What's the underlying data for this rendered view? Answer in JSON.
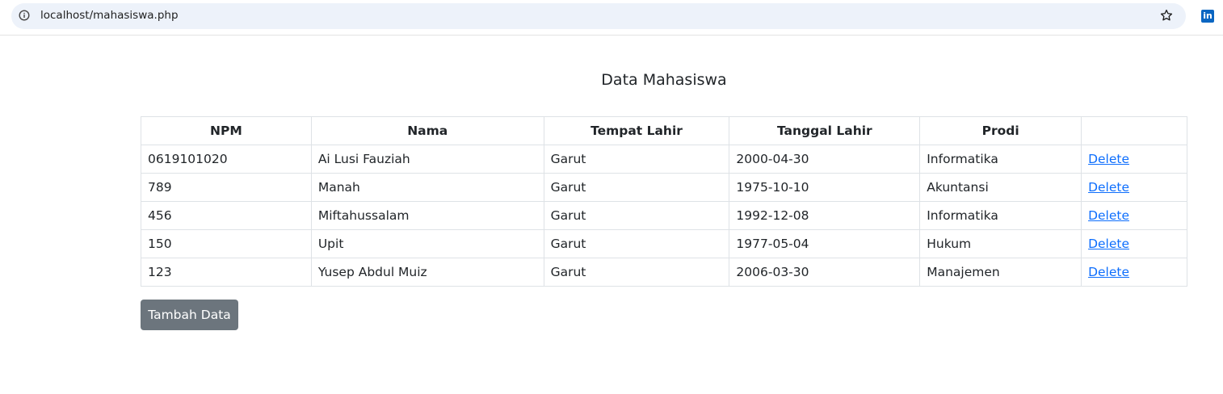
{
  "browser": {
    "url": "localhost/mahasiswa.php",
    "info_icon": "info-circle-icon",
    "bookmark_icon": "star-outline-icon",
    "extension_icon": "linkedin-icon",
    "extension_label": "in"
  },
  "page": {
    "title": "Data Mahasiswa"
  },
  "table": {
    "headers": [
      "NPM",
      "Nama",
      "Tempat Lahir",
      "Tanggal Lahir",
      "Prodi",
      ""
    ],
    "rows": [
      {
        "npm": "0619101020",
        "nama": "Ai Lusi Fauziah",
        "tempat": "Garut",
        "tanggal": "2000-04-30",
        "prodi": "Informatika",
        "action": "Delete"
      },
      {
        "npm": "789",
        "nama": "Manah",
        "tempat": "Garut",
        "tanggal": "1975-10-10",
        "prodi": "Akuntansi",
        "action": "Delete"
      },
      {
        "npm": "456",
        "nama": "Miftahussalam",
        "tempat": "Garut",
        "tanggal": "1992-12-08",
        "prodi": "Informatika",
        "action": "Delete"
      },
      {
        "npm": "150",
        "nama": "Upit",
        "tempat": "Garut",
        "tanggal": "1977-05-04",
        "prodi": "Hukum",
        "action": "Delete"
      },
      {
        "npm": "123",
        "nama": "Yusep Abdul Muiz",
        "tempat": "Garut",
        "tanggal": "2006-03-30",
        "prodi": "Manajemen",
        "action": "Delete"
      }
    ]
  },
  "actions": {
    "add_label": "Tambah Data"
  },
  "colors": {
    "link": "#0d6efd",
    "button_secondary": "#6c757d",
    "omnibox": "#edf2fa",
    "linkedin": "#0a66c2"
  }
}
